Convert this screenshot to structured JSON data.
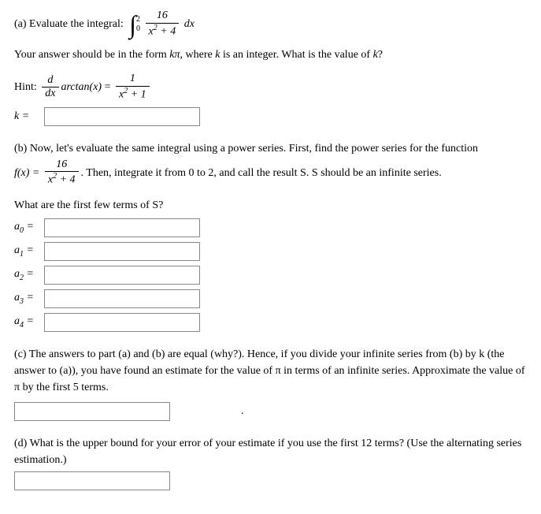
{
  "a": {
    "prompt": "(a) Evaluate the integral:",
    "int_upper": "2",
    "int_lower": "0",
    "frac_num": "16",
    "frac_den_a": "x",
    "frac_den_b": " + 4",
    "dx": "dx",
    "line2_a": "Your answer should be in the form ",
    "line2_b": "kπ",
    "line2_c": ", where ",
    "line2_d": "k",
    "line2_e": " is an integer. What is the value of ",
    "line2_f": "k",
    "line2_g": "?",
    "hint_label": "Hint: ",
    "hint_d": "d",
    "hint_dx": "dx",
    "hint_arctan": "arctan(x)",
    "hint_eq": " = ",
    "hint_rn": "1",
    "hint_rd_a": "x",
    "hint_rd_b": " + 1",
    "k_label": "k = "
  },
  "b": {
    "p1": "(b) Now, let's evaluate the same integral using a power series. First, find the power series for the function",
    "fx": "f(x) = ",
    "fn": "16",
    "fd_a": "x",
    "fd_b": " + 4",
    "p2": ". Then, integrate it from 0 to 2, and call the result S. S should be an infinite series.",
    "q": "What are the first few terms of S?",
    "labels": [
      "a",
      "a",
      "a",
      "a",
      "a"
    ],
    "subs": [
      "0",
      "1",
      "2",
      "3",
      "4"
    ]
  },
  "c": {
    "p": "(c) The answers to part (a) and (b) are equal (why?). Hence, if you divide your infinite series from (b) by k (the answer to (a)), you have found an estimate for the value of π in terms of an infinite series. Approximate the value of π by the first 5 terms.",
    "dot": "."
  },
  "d": {
    "p": "(d) What is the upper bound for your error of your estimate if you use the first 12 terms? (Use the alternating series estimation.)"
  }
}
